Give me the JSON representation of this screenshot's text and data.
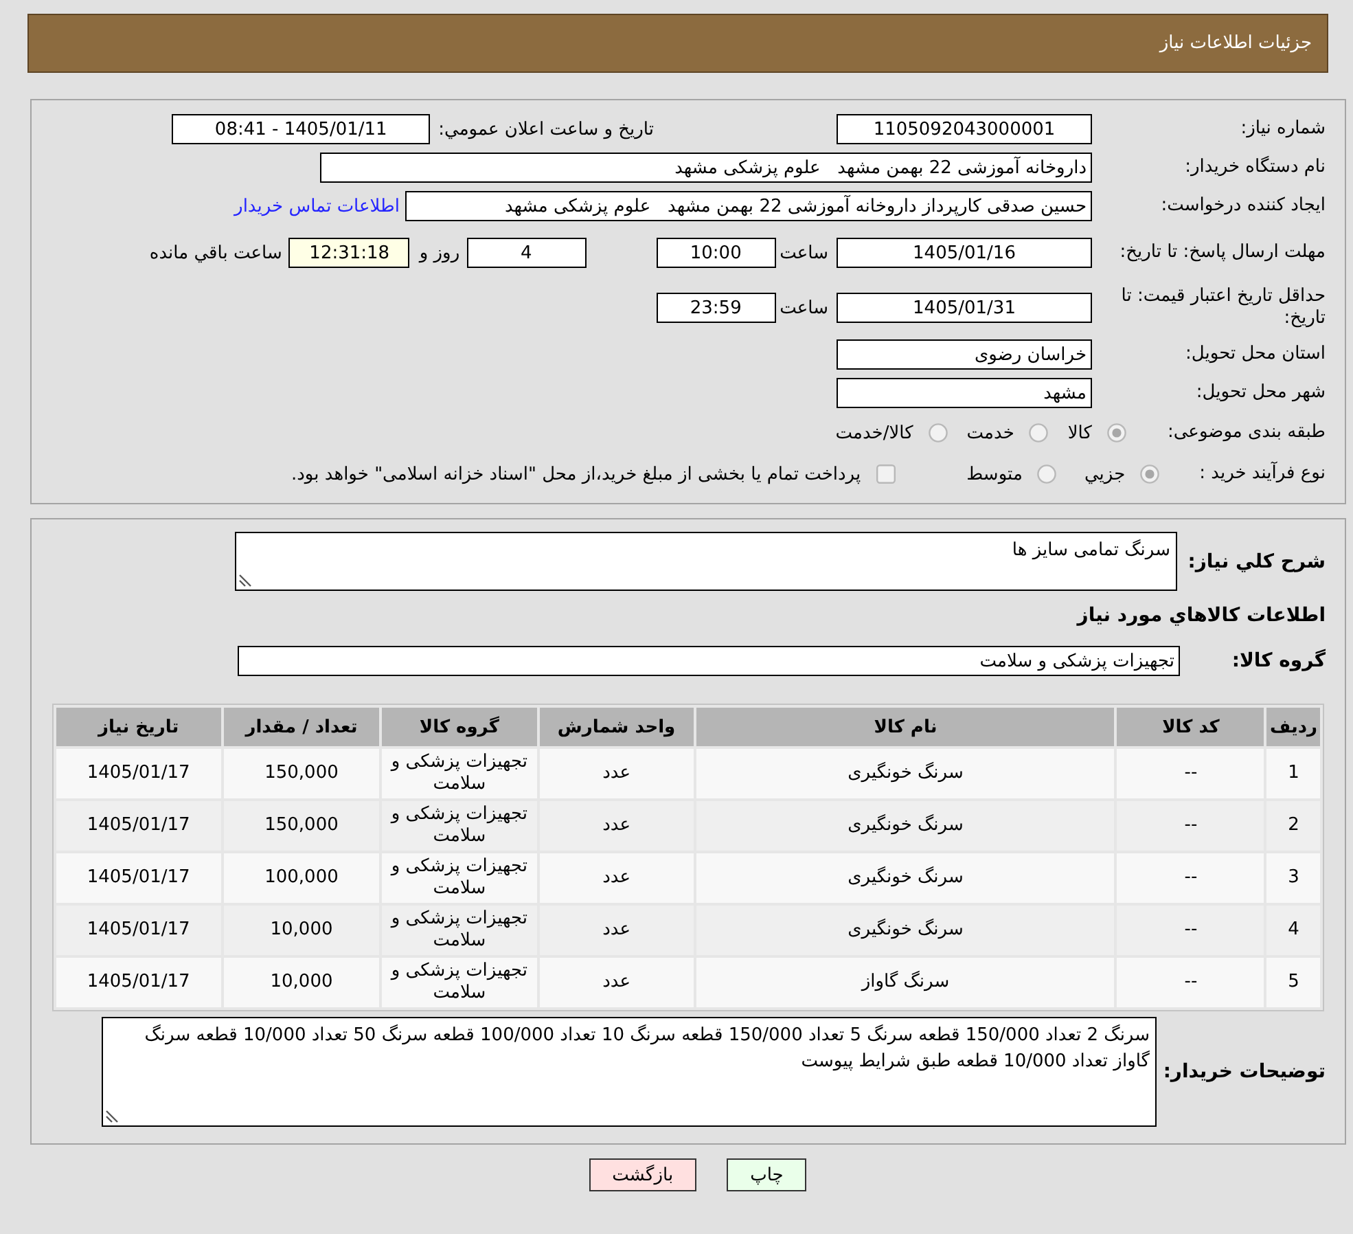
{
  "header": {
    "title": "جزئیات اطلاعات نیاز"
  },
  "details": {
    "need_number": {
      "label": "شماره نیاز:",
      "value": "1105092043000001"
    },
    "announcement": {
      "label": "تاريخ و ساعت اعلان عمومي:",
      "value": "1405/01/11 - 08:41"
    },
    "buyer_org": {
      "label": "نام دستگاه خریدار:",
      "value": "داروخانه آموزشی 22 بهمن مشهد   علوم پزشکی مشهد"
    },
    "requester": {
      "label": "ایجاد کننده درخواست:",
      "value": "حسین صدقی کارپرداز داروخانه آموزشی 22 بهمن مشهد   علوم پزشکی مشهد",
      "link": "اطلاعات تماس خریدار"
    },
    "response_deadline": {
      "label": "مهلت ارسال پاسخ: تا تاریخ:",
      "date": "1405/01/16",
      "time_label": "ساعت",
      "time": "10:00",
      "days": "4",
      "days_label": "روز و",
      "remaining": "12:31:18",
      "remaining_label": "ساعت باقي مانده"
    },
    "price_validity": {
      "label": "حداقل تاریخ اعتبار قیمت: تا تاریخ:",
      "date": "1405/01/31",
      "time_label": "ساعت",
      "time": "23:59"
    },
    "province": {
      "label": "استان محل تحویل:",
      "value": "خراسان رضوی"
    },
    "city": {
      "label": "شهر محل تحویل:",
      "value": "مشهد"
    },
    "category": {
      "label": "طبقه بندی موضوعی:",
      "options": [
        {
          "label": "کالا",
          "selected": true
        },
        {
          "label": "خدمت",
          "selected": false
        },
        {
          "label": "کالا/خدمت",
          "selected": false
        }
      ]
    },
    "purchase_type": {
      "label": "نوع فرآیند خرید :",
      "options": [
        {
          "label": "جزيي",
          "selected": true
        },
        {
          "label": "متوسط",
          "selected": false
        }
      ],
      "treasury": {
        "label": "پرداخت تمام یا بخشی از مبلغ خرید،از محل \"اسناد خزانه اسلامی\" خواهد بود.",
        "checked": false
      }
    }
  },
  "description": {
    "label": "شرح کلي نياز:",
    "value": "سرنگ تمامی سایز ها"
  },
  "goods_heading": "اطلاعات کالاهاي مورد نياز",
  "goods_group": {
    "label": "گروه کالا:",
    "value": "تجهیزات پزشکی و سلامت"
  },
  "table": {
    "columns": [
      "ردیف",
      "کد کالا",
      "نام کالا",
      "واحد شمارش",
      "گروه کالا",
      "تعداد / مقدار",
      "تاریخ نیاز"
    ],
    "rows": [
      [
        "1",
        "--",
        "سرنگ خونگیری",
        "عدد",
        "تجهیزات پزشکی و سلامت",
        "150,000",
        "1405/01/17"
      ],
      [
        "2",
        "--",
        "سرنگ خونگیری",
        "عدد",
        "تجهیزات پزشکی و سلامت",
        "150,000",
        "1405/01/17"
      ],
      [
        "3",
        "--",
        "سرنگ خونگیری",
        "عدد",
        "تجهیزات پزشکی و سلامت",
        "100,000",
        "1405/01/17"
      ],
      [
        "4",
        "--",
        "سرنگ خونگیری",
        "عدد",
        "تجهیزات پزشکی و سلامت",
        "10,000",
        "1405/01/17"
      ],
      [
        "5",
        "--",
        "سرنگ گاواز",
        "عدد",
        "تجهیزات پزشکی و سلامت",
        "10,000",
        "1405/01/17"
      ]
    ]
  },
  "buyer_notes": {
    "label": "توضیحات خریدار:",
    "value": "سرنگ 2 تعداد 150/000 قطعه سرنگ 5 تعداد 150/000 قطعه سرنگ 10 تعداد 100/000 قطعه سرنگ 50 تعداد 10/000 قطعه سرنگ گاواز تعداد 10/000 قطعه طبق شرایط پیوست"
  },
  "buttons": [
    {
      "label": "چاپ",
      "kind": "print"
    },
    {
      "label": "بازگشت",
      "kind": "back"
    }
  ]
}
